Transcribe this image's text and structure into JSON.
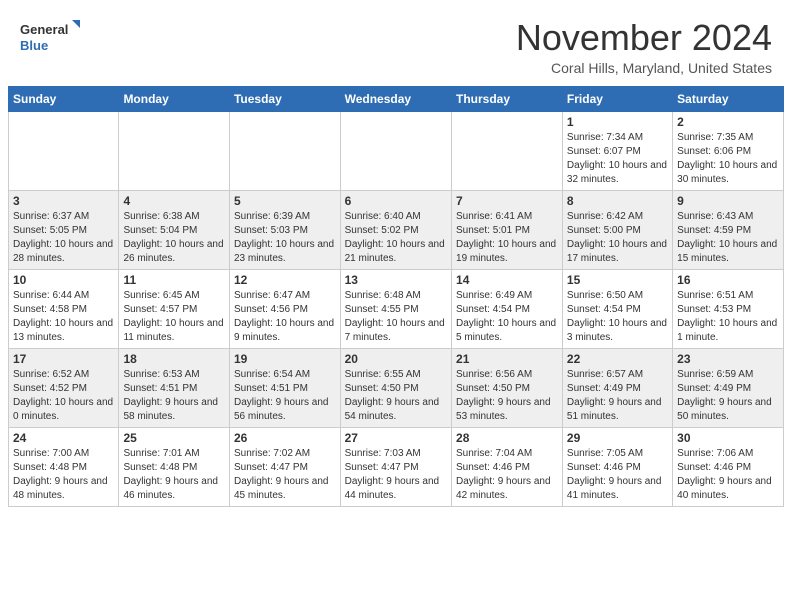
{
  "header": {
    "logo_line1": "General",
    "logo_line2": "Blue",
    "month": "November 2024",
    "location": "Coral Hills, Maryland, United States"
  },
  "weekdays": [
    "Sunday",
    "Monday",
    "Tuesday",
    "Wednesday",
    "Thursday",
    "Friday",
    "Saturday"
  ],
  "weeks": [
    [
      {
        "day": "",
        "info": ""
      },
      {
        "day": "",
        "info": ""
      },
      {
        "day": "",
        "info": ""
      },
      {
        "day": "",
        "info": ""
      },
      {
        "day": "",
        "info": ""
      },
      {
        "day": "1",
        "info": "Sunrise: 7:34 AM\nSunset: 6:07 PM\nDaylight: 10 hours and 32 minutes."
      },
      {
        "day": "2",
        "info": "Sunrise: 7:35 AM\nSunset: 6:06 PM\nDaylight: 10 hours and 30 minutes."
      }
    ],
    [
      {
        "day": "3",
        "info": "Sunrise: 6:37 AM\nSunset: 5:05 PM\nDaylight: 10 hours and 28 minutes."
      },
      {
        "day": "4",
        "info": "Sunrise: 6:38 AM\nSunset: 5:04 PM\nDaylight: 10 hours and 26 minutes."
      },
      {
        "day": "5",
        "info": "Sunrise: 6:39 AM\nSunset: 5:03 PM\nDaylight: 10 hours and 23 minutes."
      },
      {
        "day": "6",
        "info": "Sunrise: 6:40 AM\nSunset: 5:02 PM\nDaylight: 10 hours and 21 minutes."
      },
      {
        "day": "7",
        "info": "Sunrise: 6:41 AM\nSunset: 5:01 PM\nDaylight: 10 hours and 19 minutes."
      },
      {
        "day": "8",
        "info": "Sunrise: 6:42 AM\nSunset: 5:00 PM\nDaylight: 10 hours and 17 minutes."
      },
      {
        "day": "9",
        "info": "Sunrise: 6:43 AM\nSunset: 4:59 PM\nDaylight: 10 hours and 15 minutes."
      }
    ],
    [
      {
        "day": "10",
        "info": "Sunrise: 6:44 AM\nSunset: 4:58 PM\nDaylight: 10 hours and 13 minutes."
      },
      {
        "day": "11",
        "info": "Sunrise: 6:45 AM\nSunset: 4:57 PM\nDaylight: 10 hours and 11 minutes."
      },
      {
        "day": "12",
        "info": "Sunrise: 6:47 AM\nSunset: 4:56 PM\nDaylight: 10 hours and 9 minutes."
      },
      {
        "day": "13",
        "info": "Sunrise: 6:48 AM\nSunset: 4:55 PM\nDaylight: 10 hours and 7 minutes."
      },
      {
        "day": "14",
        "info": "Sunrise: 6:49 AM\nSunset: 4:54 PM\nDaylight: 10 hours and 5 minutes."
      },
      {
        "day": "15",
        "info": "Sunrise: 6:50 AM\nSunset: 4:54 PM\nDaylight: 10 hours and 3 minutes."
      },
      {
        "day": "16",
        "info": "Sunrise: 6:51 AM\nSunset: 4:53 PM\nDaylight: 10 hours and 1 minute."
      }
    ],
    [
      {
        "day": "17",
        "info": "Sunrise: 6:52 AM\nSunset: 4:52 PM\nDaylight: 10 hours and 0 minutes."
      },
      {
        "day": "18",
        "info": "Sunrise: 6:53 AM\nSunset: 4:51 PM\nDaylight: 9 hours and 58 minutes."
      },
      {
        "day": "19",
        "info": "Sunrise: 6:54 AM\nSunset: 4:51 PM\nDaylight: 9 hours and 56 minutes."
      },
      {
        "day": "20",
        "info": "Sunrise: 6:55 AM\nSunset: 4:50 PM\nDaylight: 9 hours and 54 minutes."
      },
      {
        "day": "21",
        "info": "Sunrise: 6:56 AM\nSunset: 4:50 PM\nDaylight: 9 hours and 53 minutes."
      },
      {
        "day": "22",
        "info": "Sunrise: 6:57 AM\nSunset: 4:49 PM\nDaylight: 9 hours and 51 minutes."
      },
      {
        "day": "23",
        "info": "Sunrise: 6:59 AM\nSunset: 4:49 PM\nDaylight: 9 hours and 50 minutes."
      }
    ],
    [
      {
        "day": "24",
        "info": "Sunrise: 7:00 AM\nSunset: 4:48 PM\nDaylight: 9 hours and 48 minutes."
      },
      {
        "day": "25",
        "info": "Sunrise: 7:01 AM\nSunset: 4:48 PM\nDaylight: 9 hours and 46 minutes."
      },
      {
        "day": "26",
        "info": "Sunrise: 7:02 AM\nSunset: 4:47 PM\nDaylight: 9 hours and 45 minutes."
      },
      {
        "day": "27",
        "info": "Sunrise: 7:03 AM\nSunset: 4:47 PM\nDaylight: 9 hours and 44 minutes."
      },
      {
        "day": "28",
        "info": "Sunrise: 7:04 AM\nSunset: 4:46 PM\nDaylight: 9 hours and 42 minutes."
      },
      {
        "day": "29",
        "info": "Sunrise: 7:05 AM\nSunset: 4:46 PM\nDaylight: 9 hours and 41 minutes."
      },
      {
        "day": "30",
        "info": "Sunrise: 7:06 AM\nSunset: 4:46 PM\nDaylight: 9 hours and 40 minutes."
      }
    ]
  ]
}
